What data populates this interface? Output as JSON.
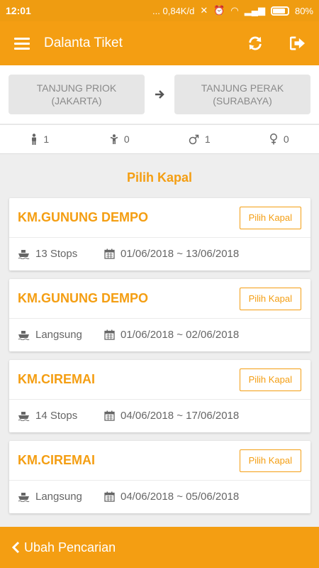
{
  "status_bar": {
    "time": "12:01",
    "network_speed": "... 0,84K/d",
    "battery": "80%"
  },
  "app_bar": {
    "title": "Dalanta Tiket"
  },
  "route": {
    "origin": {
      "name": "TANJUNG PRIOK",
      "city": "(JAKARTA)"
    },
    "destination": {
      "name": "TANJUNG PERAK",
      "city": "(SURABAYA)"
    }
  },
  "passengers": {
    "adult": "1",
    "child": "0",
    "male": "1",
    "female": "0"
  },
  "section_title": "Pilih Kapal",
  "ships": [
    {
      "name": "KM.GUNUNG DEMPO",
      "button": "Pilih Kapal",
      "stops": "13 Stops",
      "dates": "01/06/2018 ~ 13/06/2018"
    },
    {
      "name": "KM.GUNUNG DEMPO",
      "button": "Pilih Kapal",
      "stops": "Langsung",
      "dates": "01/06/2018 ~ 02/06/2018"
    },
    {
      "name": "KM.CIREMAI",
      "button": "Pilih Kapal",
      "stops": "14 Stops",
      "dates": "04/06/2018 ~ 17/06/2018"
    },
    {
      "name": "KM.CIREMAI",
      "button": "Pilih Kapal",
      "stops": "Langsung",
      "dates": "04/06/2018 ~ 05/06/2018"
    }
  ],
  "bottom_bar": {
    "label": "Ubah Pencarian"
  },
  "colors": {
    "accent": "#f49e12",
    "background": "#eeeeee"
  }
}
